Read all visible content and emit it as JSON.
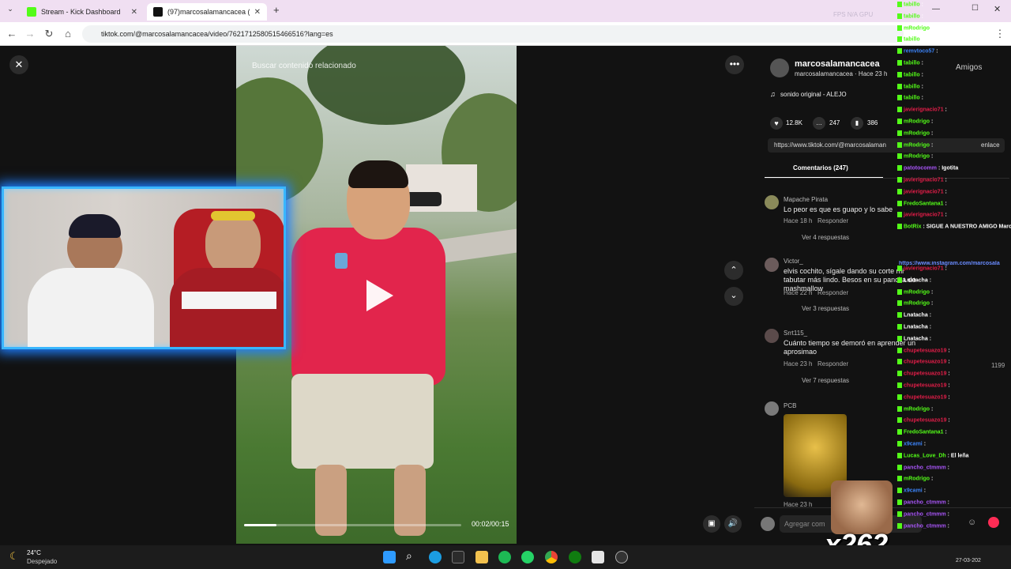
{
  "browser": {
    "tabs": [
      {
        "title": "Stream - Kick Dashboard",
        "active": false
      },
      {
        "title": "(97)marcosalamancacea (@mar",
        "active": true
      }
    ],
    "url": "tiktok.com/@marcosalamancacea/video/7621712580515466516?lang=es",
    "overlay_stats": "FPS N/A   GPU"
  },
  "video": {
    "search_related": "Buscar contenido relacionado",
    "timecode": "00:02/00:15",
    "progress": 0.15
  },
  "profile": {
    "username": "marcosalamancacea",
    "subline": "marcosalamancacea · Hace 23 h",
    "sound": "sonido original - ALEJO",
    "follow_label": "Amigos",
    "likes": "12.8K",
    "comments_count": "247",
    "saves": "386",
    "link": "https://www.tiktok.com/@marcosalaman",
    "copy_link": "enlace"
  },
  "comments_tab": "Comentarios (247)",
  "comments": [
    {
      "name": "Mapache Pirata",
      "text": "Lo peor es que es guapo y lo sabe",
      "meta": "Hace 18 h",
      "reply": "Responder",
      "more": "Ver 4 respuestas"
    },
    {
      "name": "Victor_",
      "text": "elvis cochito, sígale dando su corte mi tabutar más lindo. Besos en su pancita de mashmallow",
      "meta": "Hace 22 h",
      "reply": "Responder",
      "more": "Ver 3 respuestas"
    },
    {
      "name": "Srrt115_",
      "text": "Cuánto tiempo se demoró en aprender un aprosimao",
      "meta": "Hace 23 h",
      "reply": "Responder",
      "more": "Ver 7 respuestas",
      "likes": "1199"
    },
    {
      "name": "PCB",
      "text": "",
      "meta": "Hace 23 h",
      "reply": "Responder",
      "more": ""
    }
  ],
  "comment_input_placeholder": "Agregar com",
  "chat": [
    {
      "user": "tabillo",
      "msg": ":",
      "color": "#53fc18"
    },
    {
      "user": "tabillo",
      "msg": ":",
      "color": "#53fc18"
    },
    {
      "user": "mRodrigo",
      "msg": ":",
      "color": "#53fc18"
    },
    {
      "user": "tabillo",
      "msg": ":",
      "color": "#53fc18"
    },
    {
      "user": "remvtoco57",
      "msg": ":",
      "color": "#3b82f6"
    },
    {
      "user": "tabillo",
      "msg": ":",
      "color": "#53fc18"
    },
    {
      "user": "tabillo",
      "msg": ":",
      "color": "#53fc18"
    },
    {
      "user": "tabillo",
      "msg": ":",
      "color": "#53fc18"
    },
    {
      "user": "tabillo",
      "msg": ":",
      "color": "#53fc18"
    },
    {
      "user": "javierignacio71",
      "msg": ":",
      "color": "#e11d48"
    },
    {
      "user": "mRodrigo",
      "msg": ":",
      "color": "#53fc18"
    },
    {
      "user": "mRodrigo",
      "msg": ":",
      "color": "#53fc18"
    },
    {
      "user": "mRodrigo",
      "msg": ":",
      "color": "#53fc18"
    },
    {
      "user": "mRodrigo",
      "msg": ":",
      "color": "#53fc18"
    },
    {
      "user": "patotocomm",
      "msg": ": Igotita",
      "color": "#a855f7"
    },
    {
      "user": "javierignacio71",
      "msg": ":",
      "color": "#e11d48"
    },
    {
      "user": "javierignacio71",
      "msg": ":",
      "color": "#e11d48"
    },
    {
      "user": "FredoSantana1",
      "msg": ":",
      "color": "#53fc18"
    },
    {
      "user": "javierignacio71",
      "msg": ":",
      "color": "#e11d48"
    },
    {
      "user": "BotRix",
      "msg": ": SIGUE A NUESTRO AMIGO Marcos",
      "color": "#53fc18"
    },
    {
      "user": "javierignacio71",
      "msg": ":",
      "color": "#e11d48"
    },
    {
      "user": "Lnatacha",
      "msg": ":",
      "color": "#ffffff"
    },
    {
      "user": "mRodrigo",
      "msg": ":",
      "color": "#53fc18"
    },
    {
      "user": "mRodrigo",
      "msg": ":",
      "color": "#53fc18"
    },
    {
      "user": "Lnatacha",
      "msg": ":",
      "color": "#ffffff"
    },
    {
      "user": "Lnatacha",
      "msg": ":",
      "color": "#ffffff"
    },
    {
      "user": "Lnatacha",
      "msg": ":",
      "color": "#ffffff"
    },
    {
      "user": "chupetesuazo19",
      "msg": ":",
      "color": "#e11d48"
    },
    {
      "user": "chupetesuazo19",
      "msg": ":",
      "color": "#e11d48"
    },
    {
      "user": "chupetesuazo19",
      "msg": ":",
      "color": "#e11d48"
    },
    {
      "user": "chupetesuazo19",
      "msg": ":",
      "color": "#e11d48"
    },
    {
      "user": "chupetesuazo19",
      "msg": ":",
      "color": "#e11d48"
    },
    {
      "user": "mRodrigo",
      "msg": ":",
      "color": "#53fc18"
    },
    {
      "user": "chupetesuazo19",
      "msg": ":",
      "color": "#e11d48"
    },
    {
      "user": "FredoSantana1",
      "msg": ":",
      "color": "#53fc18"
    },
    {
      "user": "x9cami",
      "msg": ":",
      "color": "#3b82f6"
    },
    {
      "user": "Lucas_Love_Dh",
      "msg": ": El leña",
      "color": "#53fc18"
    },
    {
      "user": "pancho_ctmmm",
      "msg": ":",
      "color": "#a855f7"
    },
    {
      "user": "mRodrigo",
      "msg": ":",
      "color": "#53fc18"
    },
    {
      "user": "x9cami",
      "msg": ":",
      "color": "#3b82f6"
    },
    {
      "user": "pancho_ctmmm",
      "msg": ":",
      "color": "#a855f7"
    },
    {
      "user": "pancho_ctmmm",
      "msg": ":",
      "color": "#a855f7"
    },
    {
      "user": "pancho_ctmmm",
      "msg": ":",
      "color": "#a855f7"
    }
  ],
  "chat_link": "https://www.instagram.com/marcosala",
  "emote_counter": "x262",
  "taskbar": {
    "weather_temp": "24°C",
    "weather_desc": "Despejado",
    "clock_date": "27-03-202"
  }
}
